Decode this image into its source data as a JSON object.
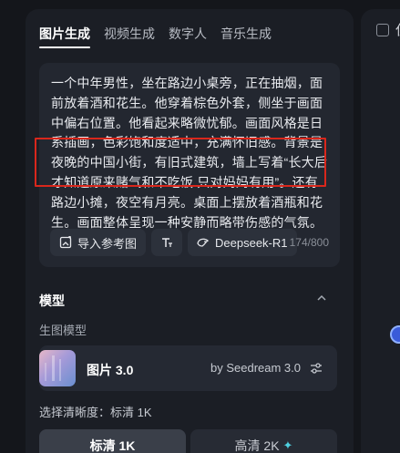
{
  "tabs": [
    {
      "label": "图片生成",
      "active": true
    },
    {
      "label": "视频生成",
      "active": false
    },
    {
      "label": "数字人",
      "active": false
    },
    {
      "label": "音乐生成",
      "active": false
    }
  ],
  "prompt": {
    "text": "一个中年男性，坐在路边小桌旁，正在抽烟，面前放着酒和花生。他穿着棕色外套，侧坐于画面中偏右位置。他看起来略微忧郁。画面风格是日系插画，色彩饱和度适中，充满怀旧感。背景是夜晚的中国小街，有旧式建筑，墙上写着“长大后才知道原来赌气和不吃饭 只对妈妈有用”。还有路边小摊，夜空有月亮。桌面上摆放着酒瓶和花生。画面整体呈现一种安静而略带伤感的气氛。",
    "tools": {
      "import_ref": "导入参考图",
      "text_tool": "T",
      "deepseek": "Deepseek-R1"
    },
    "counter": "174/800"
  },
  "model_section": {
    "title": "模型",
    "sub_label": "生图模型",
    "model_name": "图片 3.0",
    "model_by": "by Seedream 3.0"
  },
  "resolution": {
    "label": "选择清晰度：标清 1K",
    "options": [
      {
        "label": "标清 1K",
        "selected": true
      },
      {
        "label": "高清 2K",
        "selected": false
      }
    ]
  },
  "right_panel": {
    "partial_text": "仅"
  },
  "colors": {
    "accent_highlight": "#d9271c",
    "background": "#14161b",
    "panel": "#1b1e25"
  }
}
